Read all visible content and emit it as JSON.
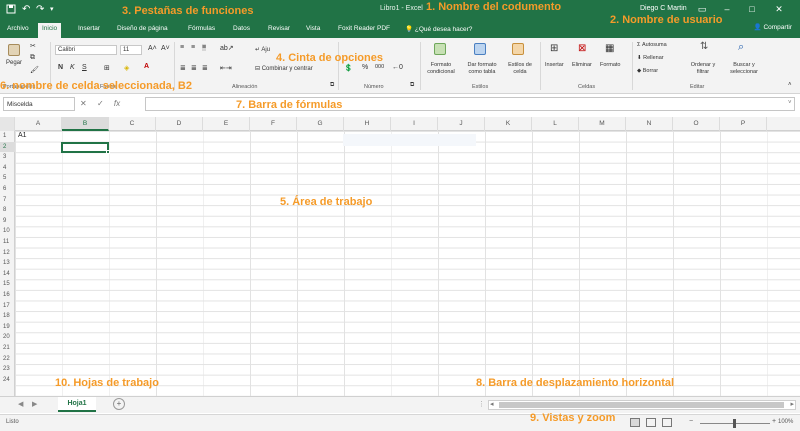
{
  "colors": {
    "accent": "#217346",
    "annotation": "#f59b29",
    "ribbon_bg": "#f3f3f3"
  },
  "titlebar": {
    "title": "Libro1 - Excel",
    "user": "Diego C Martin",
    "quick_access": [
      "save-icon",
      "undo-icon",
      "redo-icon"
    ]
  },
  "tabs": [
    {
      "label": "Archivo"
    },
    {
      "label": "Inicio"
    },
    {
      "label": "Insertar"
    },
    {
      "label": "Diseño de página"
    },
    {
      "label": "Fórmulas"
    },
    {
      "label": "Datos"
    },
    {
      "label": "Revisar"
    },
    {
      "label": "Vista"
    },
    {
      "label": "Foxit Reader PDF"
    },
    {
      "label": "¿Qué desea hacer?"
    }
  ],
  "share_label": "Compartir",
  "ribbon": {
    "paste_label": "Pegar",
    "font_name": "Calibri",
    "font_size": "11",
    "bold": "N",
    "italic": "K",
    "underline": "S",
    "wrap_label": "Aju",
    "merge_label": "Combinar y centrar",
    "number_symbols": [
      "%",
      "000"
    ],
    "conditional_label": "Formato condicional",
    "format_table_label": "Dar formato como tabla",
    "cell_styles_label": "Estilos de celda",
    "insert_label": "Insertar",
    "delete_label": "Eliminar",
    "format_label": "Formato",
    "autosum_label": "Autosuma",
    "fill_label": "Rellenar",
    "clear_label": "Borrar",
    "sort_label": "Ordenar y filtrar",
    "find_label": "Buscar y seleccionar",
    "groups": [
      "Portapapeles",
      "Fuente",
      "Alineación",
      "Número",
      "Estilos",
      "Celdas",
      "Editar"
    ]
  },
  "formula_bar": {
    "namebox_value": "Miscelda",
    "fx": "fx",
    "formula_value": ""
  },
  "columns": [
    "A",
    "B",
    "C",
    "D",
    "E",
    "F",
    "G",
    "H",
    "I",
    "J",
    "K",
    "L",
    "M",
    "N",
    "O",
    "P"
  ],
  "rows": [
    "1",
    "2",
    "3",
    "4",
    "5",
    "6",
    "7",
    "8",
    "9",
    "10",
    "11",
    "12",
    "13",
    "14",
    "15",
    "16",
    "17",
    "18",
    "19",
    "20",
    "21",
    "22",
    "23",
    "24"
  ],
  "cells": {
    "A1": "A1"
  },
  "sheet_tab": "Hoja1",
  "status": {
    "text": "Listo",
    "zoom": "100%"
  },
  "annotations": {
    "a1": "1. Nombre del codumento",
    "a2": "2. Nombre de usuario",
    "a3": "3. Pestañas de funciones",
    "a4": "4. Cinta de opciones",
    "a5": "5. Área de trabajo",
    "a6": "6. nombre de celda seleccionada, B2",
    "a7": "7. Barra de fórmulas",
    "a8": "8. Barra de desplazamiento horizontal",
    "a9": "9. Vistas y zoom",
    "a10": "10. Hojas de trabajo"
  }
}
